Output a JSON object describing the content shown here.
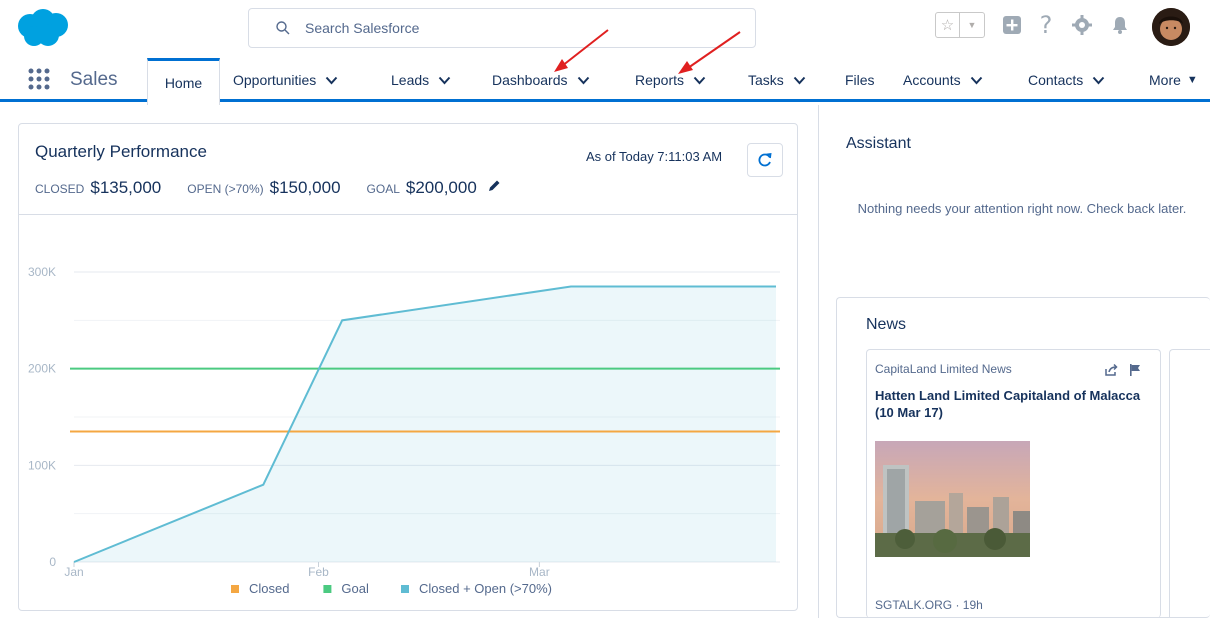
{
  "header": {
    "search_placeholder": "Search Salesforce"
  },
  "nav": {
    "app_name": "Sales",
    "items": [
      {
        "label": "Home"
      },
      {
        "label": "Opportunities"
      },
      {
        "label": "Leads"
      },
      {
        "label": "Dashboards"
      },
      {
        "label": "Reports"
      },
      {
        "label": "Tasks"
      },
      {
        "label": "Files"
      },
      {
        "label": "Accounts"
      },
      {
        "label": "Contacts"
      },
      {
        "label": "More"
      }
    ]
  },
  "performance": {
    "title": "Quarterly Performance",
    "as_of": "As of Today 7:11:03 AM",
    "closed_label": "CLOSED",
    "closed_value": "$135,000",
    "open_label": "OPEN (>70%)",
    "open_value": "$150,000",
    "goal_label": "GOAL",
    "goal_value": "$200,000"
  },
  "chart_data": {
    "type": "area",
    "title": "",
    "xlabel": "",
    "ylabel": "",
    "x_ticks": [
      "Jan",
      "Feb",
      "Mar"
    ],
    "y_ticks": [
      "0",
      "100K",
      "200K",
      "300K"
    ],
    "ylim": [
      0,
      300000
    ],
    "legend_position": "bottom",
    "grid": true,
    "series": [
      {
        "name": "Closed",
        "color": "#f4a742",
        "type": "line",
        "points": [
          {
            "x": "Jan 1",
            "y": 135000
          },
          {
            "x": "Mar 31",
            "y": 135000
          }
        ]
      },
      {
        "name": "Goal",
        "color": "#4bca81",
        "type": "line",
        "points": [
          {
            "x": "Jan 1",
            "y": 200000
          },
          {
            "x": "Mar 31",
            "y": 200000
          }
        ]
      },
      {
        "name": "Closed + Open (>70%)",
        "color": "#5fbcd3",
        "type": "area",
        "points": [
          {
            "x": "Jan 1",
            "y": 0
          },
          {
            "x": "Jan 25",
            "y": 80000
          },
          {
            "x": "Feb 4",
            "y": 250000
          },
          {
            "x": "Mar 5",
            "y": 285000
          },
          {
            "x": "Mar 31",
            "y": 285000
          }
        ]
      }
    ]
  },
  "assistant": {
    "title": "Assistant",
    "message": "Nothing needs your attention right now. Check back later."
  },
  "news": {
    "title": "News",
    "source": "CapitaLand Limited News",
    "headline": "Hatten Land Limited Capitaland of Malacca (10 Mar 17)",
    "meta": "SGTALK.ORG · 19h"
  }
}
